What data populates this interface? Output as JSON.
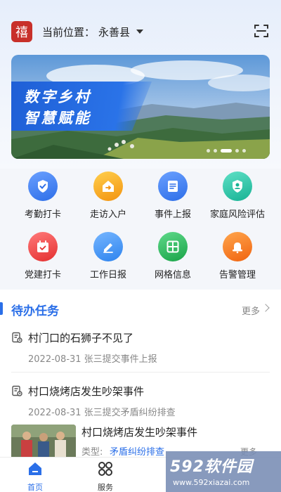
{
  "header": {
    "logo_char": "禧",
    "location_label": "当前位置：",
    "location_value": "永善县"
  },
  "banner": {
    "line1": "数字乡村",
    "line2": "智慧赋能",
    "pager_total": 5,
    "pager_active": 3
  },
  "grid": {
    "items": [
      {
        "label": "考勤打卡",
        "icon": "shield-check-icon",
        "color": "#3d7cf0"
      },
      {
        "label": "走访入户",
        "icon": "house-visit-icon",
        "color": "#f5a21a"
      },
      {
        "label": "事件上报",
        "icon": "report-doc-icon",
        "color": "#3d7cf0"
      },
      {
        "label": "家庭风险评估",
        "icon": "family-user-icon",
        "color": "#23c3a8"
      },
      {
        "label": "党建打卡",
        "icon": "party-calendar-icon",
        "color": "#ee4646"
      },
      {
        "label": "工作日报",
        "icon": "pencil-icon",
        "color": "#3d8cf0"
      },
      {
        "label": "网格信息",
        "icon": "grid-icon",
        "color": "#27b55a"
      },
      {
        "label": "告警管理",
        "icon": "alarm-bell-icon",
        "color": "#f07a20"
      }
    ]
  },
  "tasks": {
    "title": "待办任务",
    "more": "更多",
    "items": [
      {
        "title": "村门口的石狮子不见了",
        "meta": "2022-08-31 张三提交事件上报"
      },
      {
        "title": "村口烧烤店发生吵架事件",
        "meta": "2022-08-31 张三提交矛盾纠纷排查"
      }
    ],
    "photo_item": {
      "title": "村口烧烤店发生吵架事件",
      "type_label": "类型:",
      "type_value": "矛盾纠纷排查",
      "more": "更多"
    }
  },
  "tabbar": {
    "items": [
      {
        "label": "首页",
        "icon": "home-icon",
        "active": true
      },
      {
        "label": "服务",
        "icon": "apps-icon",
        "active": false
      }
    ]
  },
  "watermark": {
    "big": "592软件园",
    "small": "www.592xiazai.com"
  },
  "colors": {
    "accent": "#2b6fe8",
    "brand_red": "#c8302a"
  }
}
